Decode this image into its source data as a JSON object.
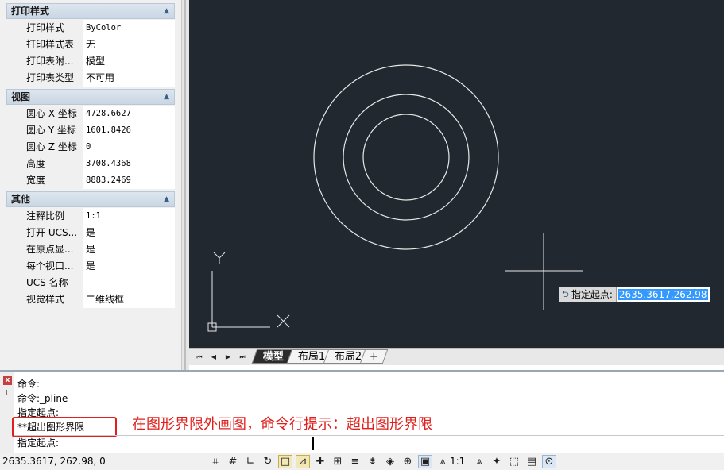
{
  "properties": {
    "sections": [
      {
        "title": "打印样式",
        "rows": [
          {
            "name": "打印样式",
            "value": "ByColor",
            "mono": true
          },
          {
            "name": "打印样式表",
            "value": "无",
            "mono": false
          },
          {
            "name": "打印表附...",
            "value": "模型",
            "mono": false
          },
          {
            "name": "打印表类型",
            "value": "不可用",
            "mono": false
          }
        ]
      },
      {
        "title": "视图",
        "rows": [
          {
            "name": "圆心 X 坐标",
            "value": "4728.6627",
            "mono": true
          },
          {
            "name": "圆心 Y 坐标",
            "value": "1601.8426",
            "mono": true
          },
          {
            "name": "圆心 Z 坐标",
            "value": "0",
            "mono": true
          },
          {
            "name": "高度",
            "value": "3708.4368",
            "mono": true
          },
          {
            "name": "宽度",
            "value": "8883.2469",
            "mono": true
          }
        ]
      },
      {
        "title": "其他",
        "rows": [
          {
            "name": "注释比例",
            "value": "1:1",
            "mono": true
          },
          {
            "name": "打开 UCS...",
            "value": "是",
            "mono": false
          },
          {
            "name": "在原点显...",
            "value": "是",
            "mono": false
          },
          {
            "name": "每个视口...",
            "value": "是",
            "mono": false
          },
          {
            "name": "UCS 名称",
            "value": "",
            "mono": false
          },
          {
            "name": "视觉样式",
            "value": "二维线框",
            "mono": false
          }
        ]
      }
    ],
    "collapse_glyph": "▲"
  },
  "canvas": {
    "background": "#212830",
    "ucs_y_label": "Y",
    "ucs_x_label": "X",
    "dynamic_input": {
      "label": "指定起点:",
      "value": "2635.3617,262.98"
    }
  },
  "layout_tabs": {
    "nav": [
      "⏮",
      "◀",
      "▶",
      "⏭"
    ],
    "tabs": [
      {
        "label": "模型",
        "active": true
      },
      {
        "label": "布局1",
        "active": false
      },
      {
        "label": "布局2",
        "active": false
      },
      {
        "label": "+",
        "active": false
      }
    ]
  },
  "command": {
    "close_glyph": "x",
    "pin_glyph": "⊥",
    "history": [
      "命令:",
      "命令:_pline",
      "指定起点:",
      "**超出图形界限"
    ],
    "prompt": "指定起点:",
    "annotation": "在图形界限外画图，命令行提示：超出图形界限"
  },
  "statusbar": {
    "coordinates": "2635.3617, 262.98, 0",
    "scale": "1:1",
    "icons": [
      "grid-snap-icon",
      "grid-icon",
      "ortho-icon",
      "polar-icon",
      "osnap-icon",
      "otrack-icon",
      "ducs-icon",
      "dyn-icon",
      "lineweight-icon",
      "selection-cycling-icon",
      "layer-icon",
      "zoom-icon",
      "viewport-icon",
      "annotation-icon",
      "annotation-scale-icon",
      "workspace-icon",
      "isolate-icon",
      "fullscreen-icon",
      "customize-icon"
    ]
  }
}
